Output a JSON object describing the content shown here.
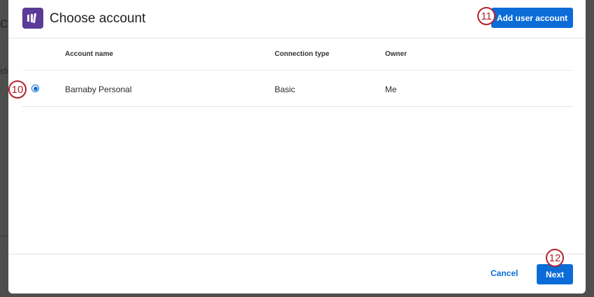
{
  "background": {
    "fragment_top": "ct",
    "fragment_mid": "sfo"
  },
  "dialog": {
    "title": "Choose account",
    "add_button": "Add user account",
    "cancel_label": "Cancel",
    "next_label": "Next"
  },
  "table": {
    "columns": {
      "name": "Account name",
      "connection": "Connection type",
      "owner": "Owner"
    },
    "rows": [
      {
        "name": "Barnaby Personal",
        "connection": "Basic",
        "owner": "Me",
        "selected": true
      }
    ]
  },
  "markers": {
    "m10": "10",
    "m11": "11",
    "m12": "12"
  },
  "colors": {
    "accent": "#0b6cd7",
    "logo": "#5b3b97",
    "marker": "#b3232f"
  }
}
